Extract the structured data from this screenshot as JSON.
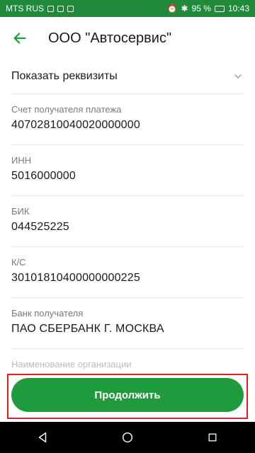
{
  "status_bar": {
    "carrier": "MTS RUS",
    "battery": "95 %",
    "time": "10:43"
  },
  "header": {
    "title": "ООО \"Автосервис\"",
    "back_icon": "arrow-left-icon"
  },
  "requisites": {
    "label": "Показать реквизиты",
    "chevron_icon": "chevron-down-icon"
  },
  "fields": [
    {
      "label": "Счет получателя платежа",
      "value": "40702810040020000000"
    },
    {
      "label": "ИНН",
      "value": "5016000000"
    },
    {
      "label": "БИК",
      "value": "044525225"
    },
    {
      "label": "К/С",
      "value": "30101810400000000225"
    },
    {
      "label": "Банк получателя",
      "value": "ПАО СБЕРБАНК Г. МОСКВА"
    },
    {
      "label": "Наименование организации"
    }
  ],
  "action": {
    "label": "Продолжить"
  },
  "colors": {
    "status_bar": "#1f8a3a",
    "primary_green": "#1f9a3c",
    "highlight_red": "#e02020"
  }
}
